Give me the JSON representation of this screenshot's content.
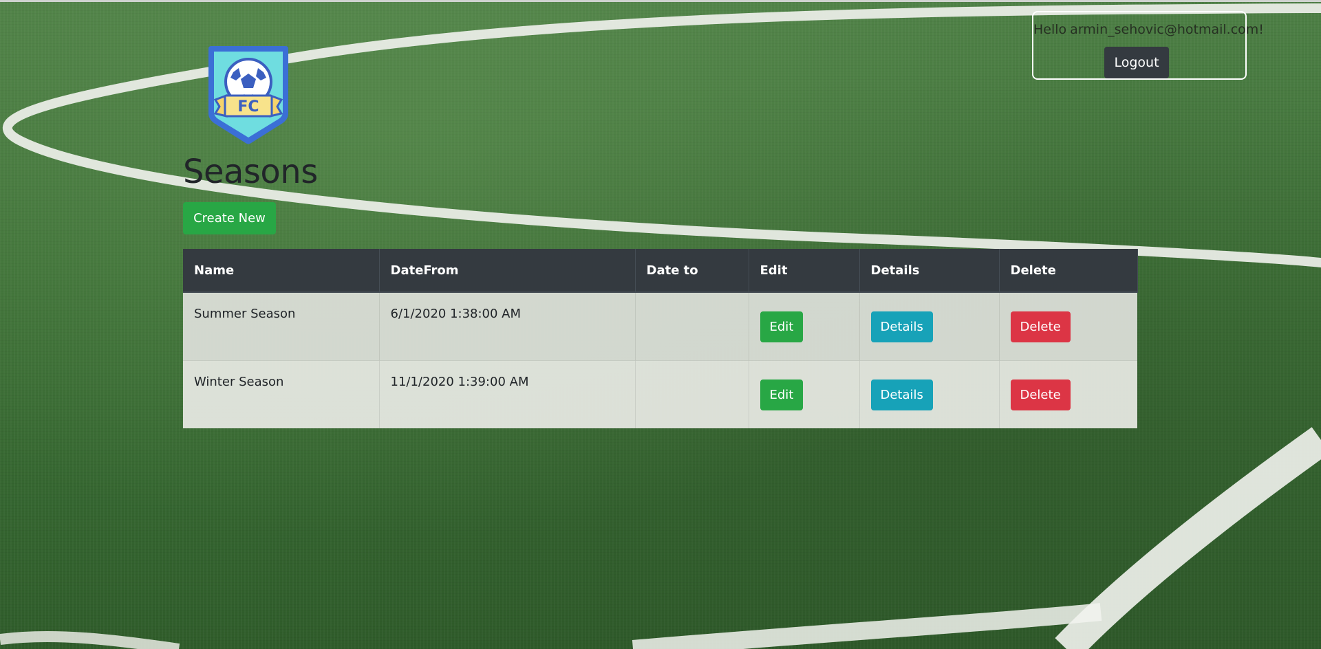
{
  "header": {
    "greeting_prefix": "Hello",
    "user_email": "armin_sehovic@hotmail.com!",
    "logout_label": "Logout"
  },
  "logo": {
    "text": "FC",
    "icon": "soccer-club-crest-icon"
  },
  "page": {
    "title": "Seasons",
    "create_label": "Create New"
  },
  "table": {
    "columns": [
      "Name",
      "DateFrom",
      "Date to",
      "Edit",
      "Details",
      "Delete"
    ],
    "rows": [
      {
        "name": "Summer Season",
        "date_from": "6/1/2020 1:38:00 AM",
        "date_to": "",
        "edit": "Edit",
        "details": "Details",
        "delete": "Delete"
      },
      {
        "name": "Winter Season",
        "date_from": "11/1/2020 1:39:00 AM",
        "date_to": "",
        "edit": "Edit",
        "details": "Details",
        "delete": "Delete"
      }
    ]
  },
  "colors": {
    "edit": "#28a745",
    "details": "#17a2b8",
    "delete": "#dc3545",
    "header_bg": "#343a40"
  }
}
